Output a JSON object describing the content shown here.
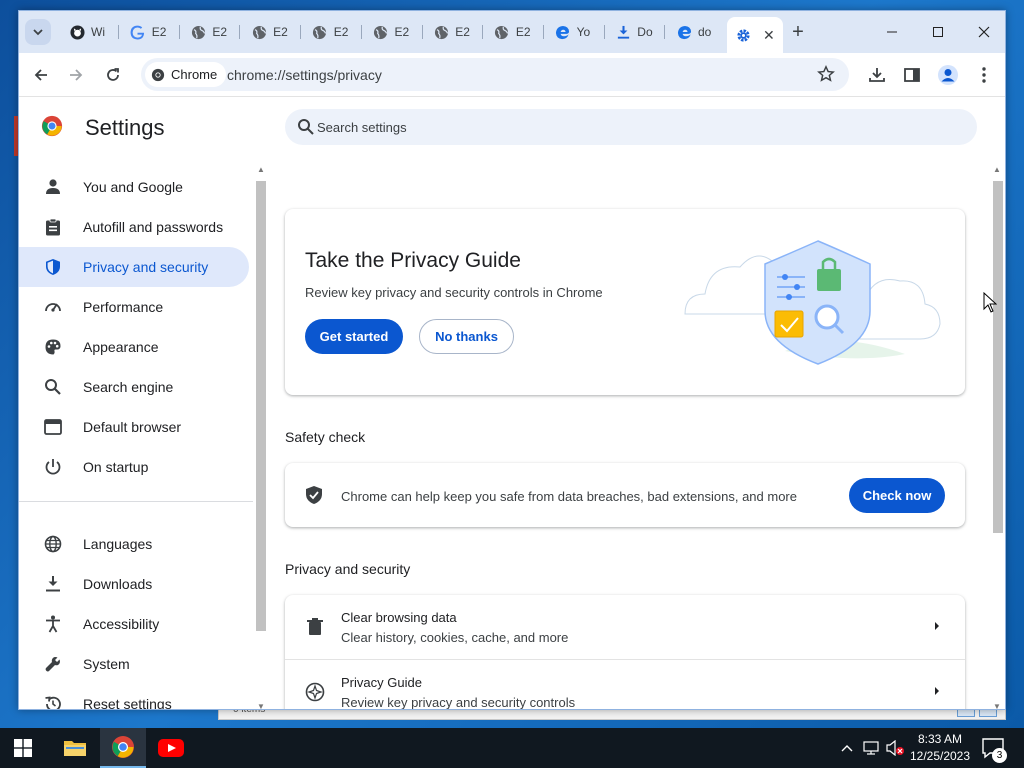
{
  "browser": {
    "tabs": [
      {
        "label": "Wi",
        "icon": "github-icon"
      },
      {
        "label": "E2",
        "icon": "google-icon"
      },
      {
        "label": "E2",
        "icon": "globe-icon"
      },
      {
        "label": "E2",
        "icon": "globe-icon"
      },
      {
        "label": "E2",
        "icon": "globe-icon"
      },
      {
        "label": "E2",
        "icon": "globe-icon"
      },
      {
        "label": "E2",
        "icon": "globe-icon"
      },
      {
        "label": "E2",
        "icon": "globe-icon"
      },
      {
        "label": "Yo",
        "icon": "edge-icon"
      },
      {
        "label": "Do",
        "icon": "download-icon"
      },
      {
        "label": "do",
        "icon": "edge-icon"
      }
    ],
    "active_tab_icon": "gear-icon",
    "new_tab_label": "+",
    "chip_label": "Chrome",
    "url": "chrome://settings/privacy"
  },
  "settings": {
    "title": "Settings",
    "search_placeholder": "Search settings",
    "nav": [
      {
        "label": "You and Google",
        "icon": "person-icon"
      },
      {
        "label": "Autofill and passwords",
        "icon": "clipboard-icon"
      },
      {
        "label": "Privacy and security",
        "icon": "shield-icon",
        "selected": true
      },
      {
        "label": "Performance",
        "icon": "speedometer-icon"
      },
      {
        "label": "Appearance",
        "icon": "palette-icon"
      },
      {
        "label": "Search engine",
        "icon": "search-icon"
      },
      {
        "label": "Default browser",
        "icon": "browser-window-icon"
      },
      {
        "label": "On startup",
        "icon": "power-icon"
      },
      {
        "label": "Languages",
        "icon": "globe-icon"
      },
      {
        "label": "Downloads",
        "icon": "download-icon"
      },
      {
        "label": "Accessibility",
        "icon": "accessibility-icon"
      },
      {
        "label": "System",
        "icon": "wrench-icon"
      },
      {
        "label": "Reset settings",
        "icon": "reset-icon"
      }
    ],
    "guide": {
      "title": "Take the Privacy Guide",
      "desc": "Review key privacy and security controls in Chrome",
      "primary": "Get started",
      "secondary": "No thanks"
    },
    "safety": {
      "section_title": "Safety check",
      "text": "Chrome can help keep you safe from data breaches, bad extensions, and more",
      "button": "Check now"
    },
    "privacy": {
      "section_title": "Privacy and security",
      "rows": [
        {
          "title": "Clear browsing data",
          "sub": "Clear history, cookies, cache, and more",
          "icon": "trash-icon"
        },
        {
          "title": "Privacy Guide",
          "sub": "Review key privacy and security controls",
          "icon": "compass-icon"
        }
      ]
    }
  },
  "behind_window": {
    "status_text": "0 items"
  },
  "taskbar": {
    "time": "8:33 AM",
    "date": "12/25/2023",
    "notification_count": "3"
  },
  "colors": {
    "accent": "#0b57d0",
    "nav_selected_bg": "#dfe8fb",
    "taskbar": "#101820"
  }
}
